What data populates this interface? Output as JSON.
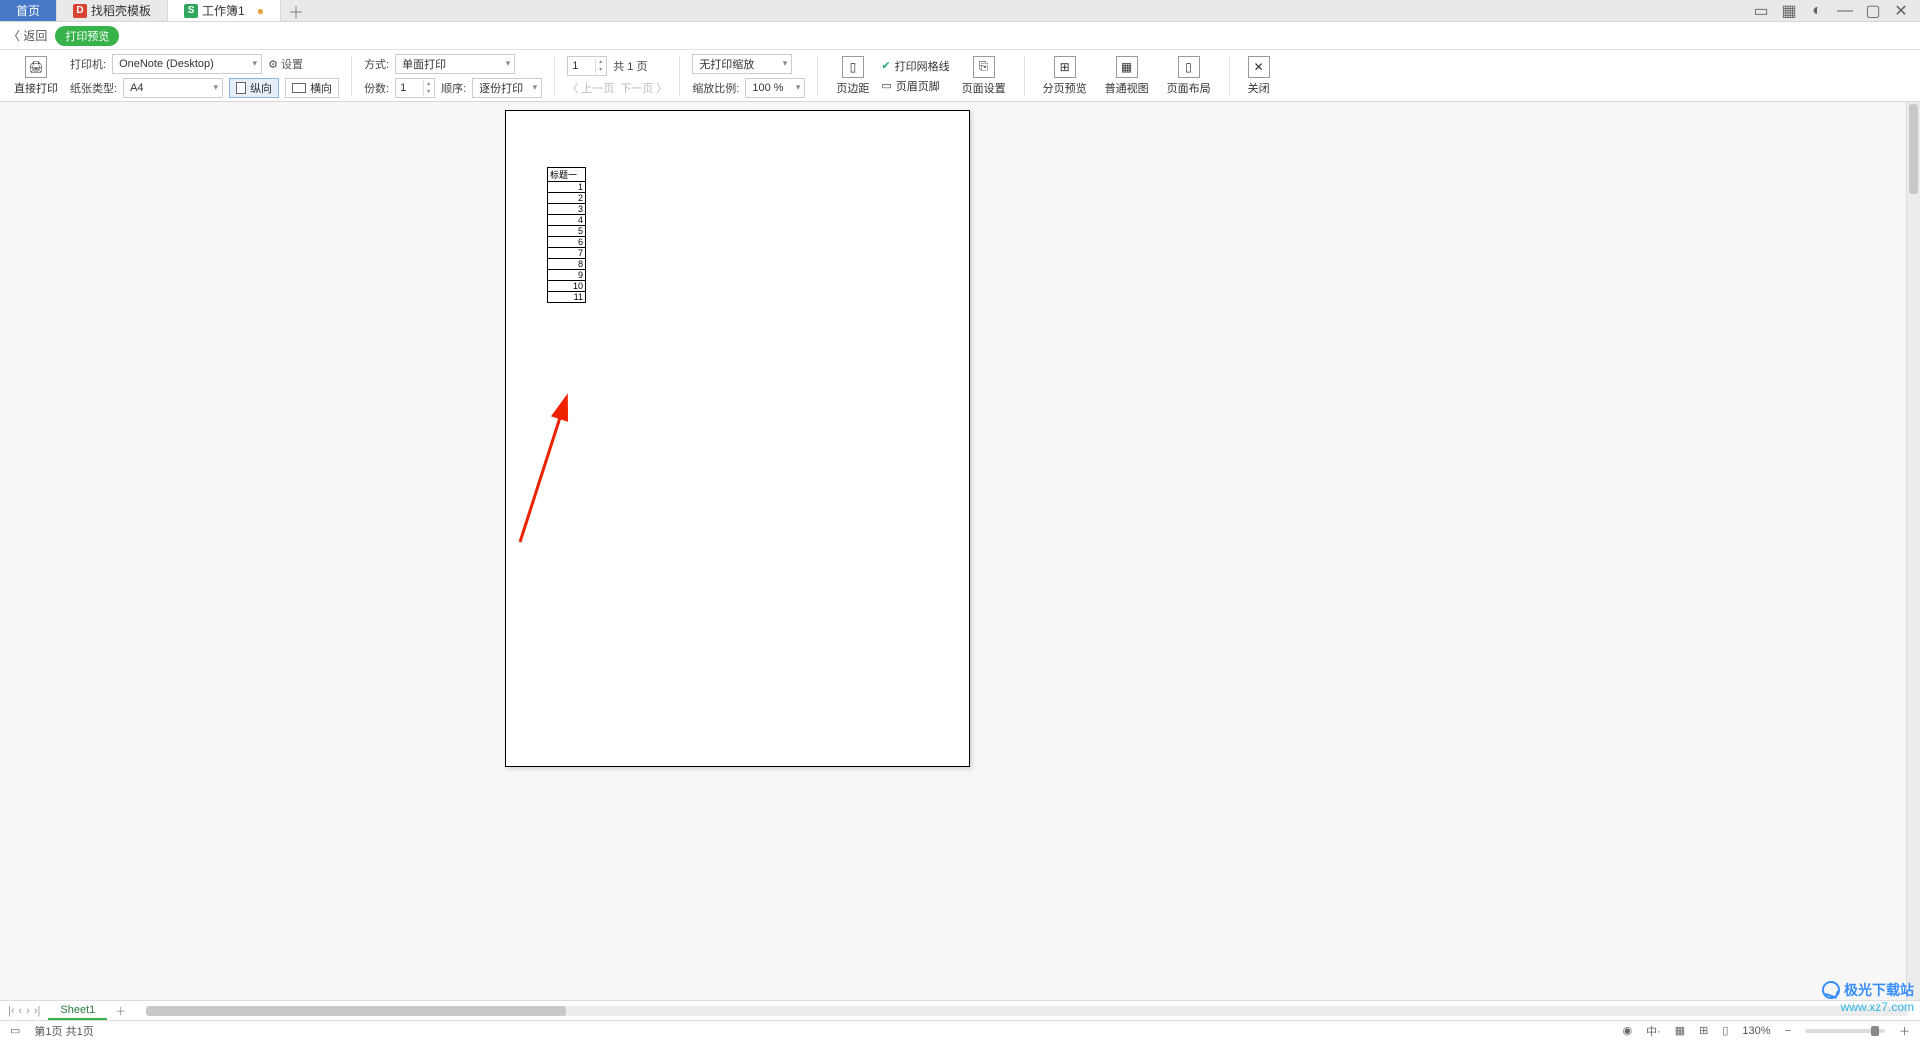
{
  "tabs": {
    "home": "首页",
    "template": "找稻壳模板",
    "doc": "工作簿1"
  },
  "bar2": {
    "back": "返回",
    "badge": "打印预览"
  },
  "toolbar": {
    "direct_print_icon_label": "直接打印",
    "printer_label": "打印机:",
    "printer_value": "OneNote (Desktop)",
    "paper_label": "纸张类型:",
    "paper_value": "A4",
    "settings": "设置",
    "portrait": "纵向",
    "landscape": "横向",
    "mode_label": "方式:",
    "mode_value": "单面打印",
    "copies_label": "份数:",
    "copies_value": "1",
    "order_label": "顺序:",
    "order_value": "逐份打印",
    "page_input": "1",
    "page_total_prefix": "共",
    "page_total_value": "1",
    "page_total_suffix": "页",
    "prev_page": "上一页",
    "next_page": "下一页",
    "scale_mode": "无打印缩放",
    "scale_ratio_label": "缩放比例:",
    "scale_ratio_value": "100 %",
    "margins": "页边距",
    "print_grid": "打印网格线",
    "header_footer": "页眉页脚",
    "page_setup": "页面设置",
    "page_break": "分页预览",
    "normal_view": "普通视图",
    "page_layout": "页面布局",
    "close": "关闭"
  },
  "sheet": {
    "header": "标题一",
    "rows": [
      "1",
      "2",
      "3",
      "4",
      "5",
      "6",
      "7",
      "8",
      "9",
      "10",
      "11"
    ]
  },
  "sheetbar": {
    "tab": "Sheet1"
  },
  "status": {
    "page_info": "第1页 共1页",
    "zoom": "130%"
  },
  "watermark": {
    "name": "极光下载站",
    "url": "www.xz7.com"
  }
}
